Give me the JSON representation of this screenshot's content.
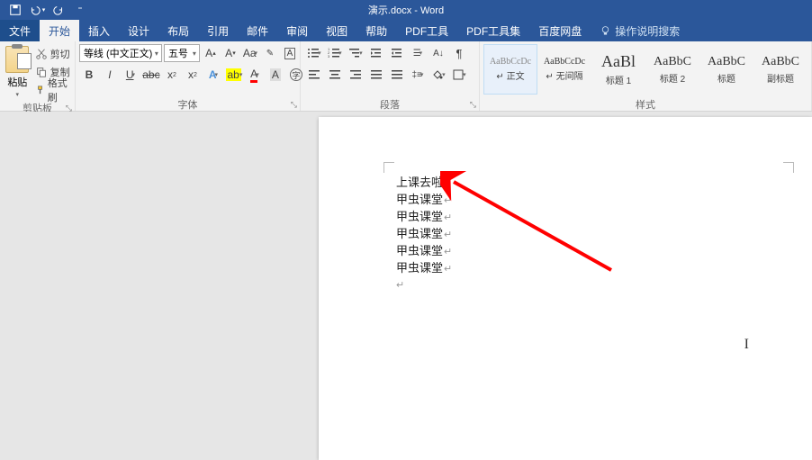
{
  "title": "演示.docx - Word",
  "qat": {
    "save": "save-icon",
    "undo": "undo-icon",
    "redo": "redo-icon"
  },
  "menu": {
    "file": "文件",
    "home": "开始",
    "insert": "插入",
    "design": "设计",
    "layout": "布局",
    "references": "引用",
    "mailings": "邮件",
    "review": "审阅",
    "view": "视图",
    "help": "帮助",
    "pdf_tool": "PDF工具",
    "pdf_toolset": "PDF工具集",
    "baidu": "百度网盘",
    "tell_me": "操作说明搜索"
  },
  "ribbon": {
    "clipboard": {
      "label": "剪贴板",
      "paste": "粘贴",
      "cut": "剪切",
      "copy": "复制",
      "format_painter": "格式刷"
    },
    "font": {
      "label": "字体",
      "font_name": "等线 (中文正文)",
      "font_size": "五号"
    },
    "paragraph": {
      "label": "段落"
    },
    "styles": {
      "label": "样式",
      "items": [
        {
          "preview": "AaBbCcDc",
          "name": "↵ 正文",
          "size": "10px",
          "selected": true
        },
        {
          "preview": "AaBbCcDc",
          "name": "↵ 无间隔",
          "size": "10px",
          "selected": false
        },
        {
          "preview": "AaBl",
          "name": "标题 1",
          "size": "18px",
          "selected": false
        },
        {
          "preview": "AaBbC",
          "name": "标题 2",
          "size": "14px",
          "selected": false
        },
        {
          "preview": "AaBbC",
          "name": "标题",
          "size": "14px",
          "selected": false
        },
        {
          "preview": "AaBbC",
          "name": "副标题",
          "size": "14px",
          "selected": false
        }
      ]
    }
  },
  "document": {
    "lines": [
      "上课去啦",
      "甲虫课堂",
      "甲虫课堂",
      "甲虫课堂",
      "甲虫课堂",
      "甲虫课堂"
    ]
  },
  "colors": {
    "ribbon_blue": "#2b579a",
    "arrow_red": "#ff0000"
  }
}
